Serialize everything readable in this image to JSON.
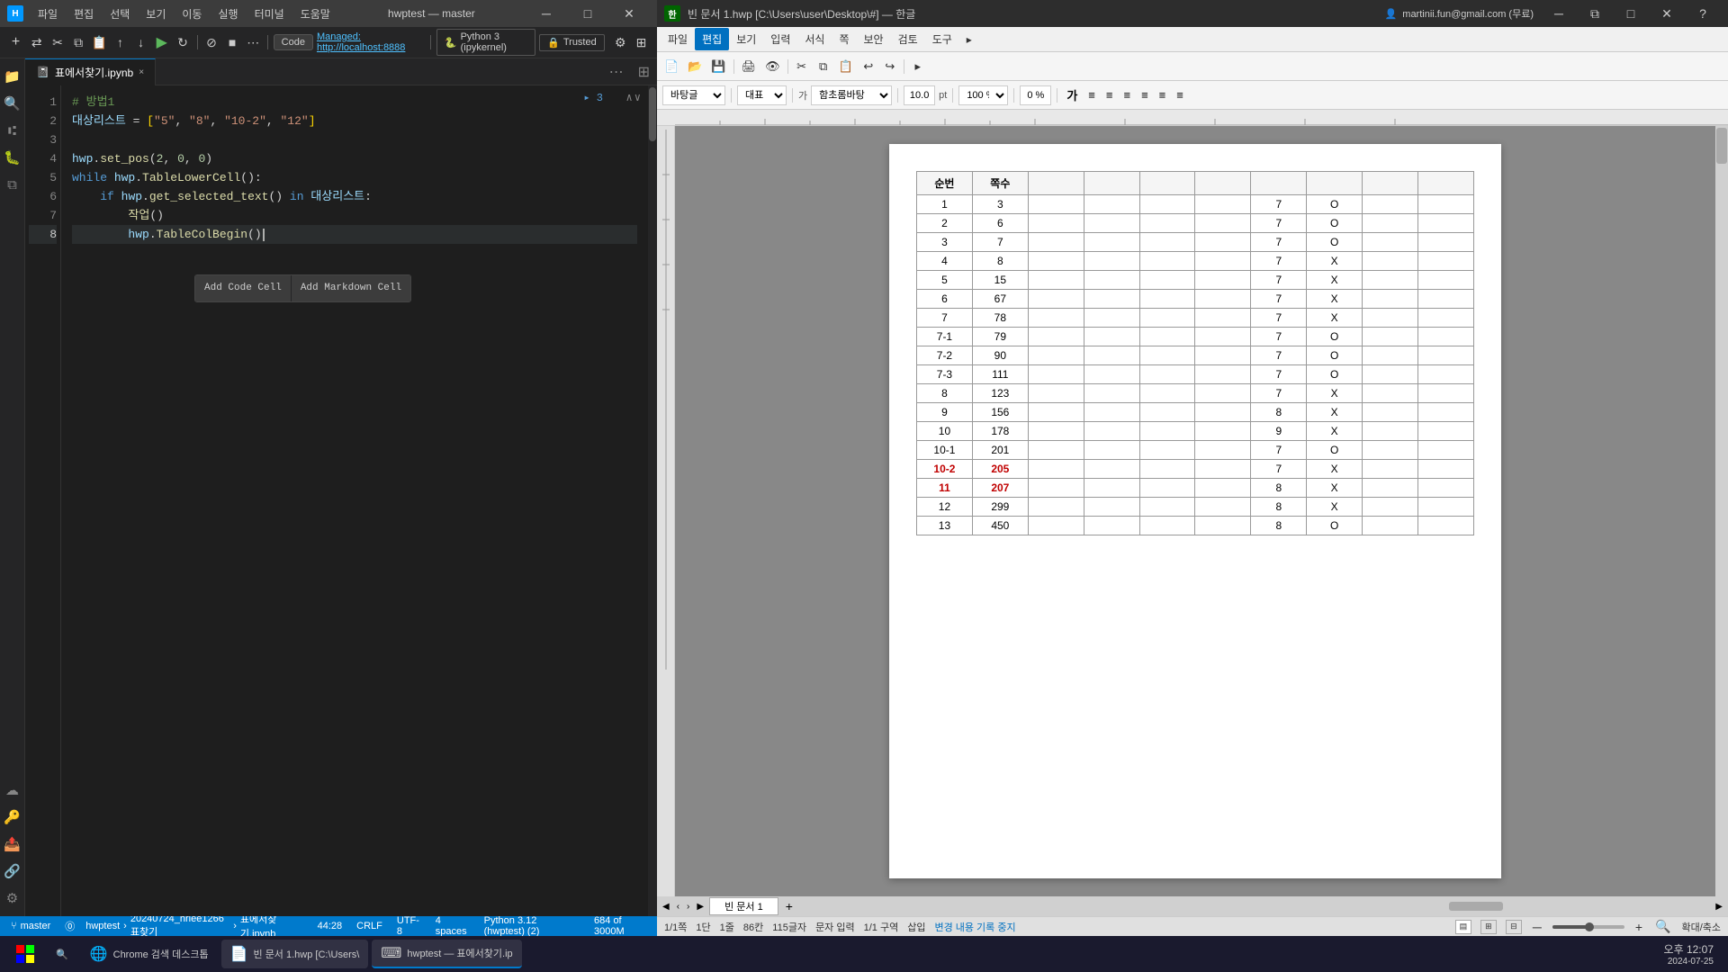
{
  "app": {
    "title": "hwptest — master",
    "tab": "표에서찾기.ipynb"
  },
  "vscode": {
    "titlebar": {
      "icon": "H",
      "project": "hwptest",
      "branch": "master",
      "menus": [
        "파일",
        "편집",
        "선택",
        "보기",
        "이동",
        "실행",
        "터미널",
        "도움말"
      ]
    },
    "toolbar": {
      "code_label": "Code",
      "managed_url": "Managed: http://localhost:8888",
      "python_label": "Python 3 (ipykernel)",
      "trusted_label": "Trusted"
    },
    "file_tab": {
      "name": "표에서찾기.ipynb",
      "close": "×"
    },
    "code_lines": [
      {
        "num": 1,
        "content": "# 방법1",
        "type": "comment"
      },
      {
        "num": 2,
        "content": "대상리스트 = [\"5\", \"8\", \"10-2\", \"12\"]",
        "type": "code"
      },
      {
        "num": 3,
        "content": "",
        "type": "empty"
      },
      {
        "num": 4,
        "content": "hwp.set_pos(2, 0, 0)",
        "type": "code"
      },
      {
        "num": 5,
        "content": "while hwp.TableLowerCell():",
        "type": "code"
      },
      {
        "num": 6,
        "content": "    if hwp.get_selected_text() in 대상리스트:",
        "type": "code"
      },
      {
        "num": 7,
        "content": "        작업()",
        "type": "code"
      },
      {
        "num": 8,
        "content": "        hwp.TableColBegin()",
        "type": "code",
        "active": true
      }
    ],
    "cell_num": "▸ 3",
    "autocomplete": {
      "btn1": "Add Code Cell",
      "btn2": "Add Markdown Cell"
    },
    "statusbar": {
      "branch": "master",
      "errors": "⓪",
      "path1": "hwptest",
      "path2": "20240724_hrlee1266표찾기",
      "path3": "표에서찾기.ipynb",
      "line_col": "44:28",
      "encoding": "CRLF",
      "charset": "UTF-8",
      "spaces": "4 spaces",
      "python": "Python 3.12 (hwptest) (2)",
      "chars": "684 of 3000M"
    }
  },
  "hwp": {
    "titlebar": {
      "title": "빈 문서 1.hwp [C:\\Users\\user\\Desktop\\#] — 한글",
      "user": "martinii.fun@gmail.com (무료)"
    },
    "menubar": {
      "items": [
        "파일",
        "편집",
        "보기",
        "입력",
        "서식",
        "쪽",
        "보안",
        "검토",
        "도구",
        "▸"
      ]
    },
    "toolbar": {
      "font": "바탕글",
      "style": "대표",
      "ref_font": "함초롬바탕",
      "size": "10.0",
      "unit": "pt",
      "zoom": "100 %",
      "angle": "0 %"
    },
    "table": {
      "headers": [
        "순번",
        "쪽수",
        "",
        "",
        "",
        "",
        "",
        "",
        ""
      ],
      "rows": [
        {
          "num": "1",
          "page": "3",
          "col7": "7",
          "col8": "O"
        },
        {
          "num": "2",
          "page": "6",
          "col7": "7",
          "col8": "O"
        },
        {
          "num": "3",
          "page": "7",
          "col7": "7",
          "col8": "O"
        },
        {
          "num": "4",
          "page": "8",
          "col7": "7",
          "col8": "X"
        },
        {
          "num": "5",
          "page": "15",
          "col7": "7",
          "col8": "X"
        },
        {
          "num": "6",
          "page": "67",
          "col7": "7",
          "col8": "X"
        },
        {
          "num": "7",
          "page": "78",
          "col7": "7",
          "col8": "X"
        },
        {
          "num": "7-1",
          "page": "79",
          "col7": "7",
          "col8": "O"
        },
        {
          "num": "7-2",
          "page": "90",
          "col7": "7",
          "col8": "O"
        },
        {
          "num": "7-3",
          "page": "111",
          "col7": "7",
          "col8": "O"
        },
        {
          "num": "8",
          "page": "123",
          "col7": "7",
          "col8": "X"
        },
        {
          "num": "9",
          "page": "156",
          "col7": "8",
          "col8": "X"
        },
        {
          "num": "10",
          "page": "178",
          "col7": "9",
          "col8": "X"
        },
        {
          "num": "10-1",
          "page": "201",
          "col7": "7",
          "col8": "O"
        },
        {
          "num": "10-2",
          "page": "205",
          "col7": "7",
          "col8": "X",
          "highlighted": true
        },
        {
          "num": "11",
          "page": "207",
          "col7": "8",
          "col8": "X",
          "highlighted": true
        },
        {
          "num": "12",
          "page": "299",
          "col7": "8",
          "col8": "X"
        },
        {
          "num": "13",
          "page": "450",
          "col7": "8",
          "col8": "O"
        }
      ]
    },
    "statusbar": {
      "page": "1/1쪽",
      "col": "1단",
      "row": "1줄",
      "char_pos": "86칸",
      "total_chars": "115글자",
      "input_mode": "문자 입력",
      "section": "1/1 구역",
      "insert_mode": "삽입",
      "recording": "변경 내용 기록 중지",
      "page_tab": "빈 문서 1"
    }
  },
  "taskbar": {
    "apps": [
      {
        "label": "Chrome 검색 데스크톱",
        "icon": "🌐"
      },
      {
        "label": "빈 문서 1.hwp [C:\\Users\\",
        "icon": "📄"
      },
      {
        "label": "hwptest — 표에서찾기.ip",
        "icon": "⌨"
      }
    ],
    "clock": {
      "time": "오후 12:07",
      "date": "2024-07-25"
    }
  }
}
